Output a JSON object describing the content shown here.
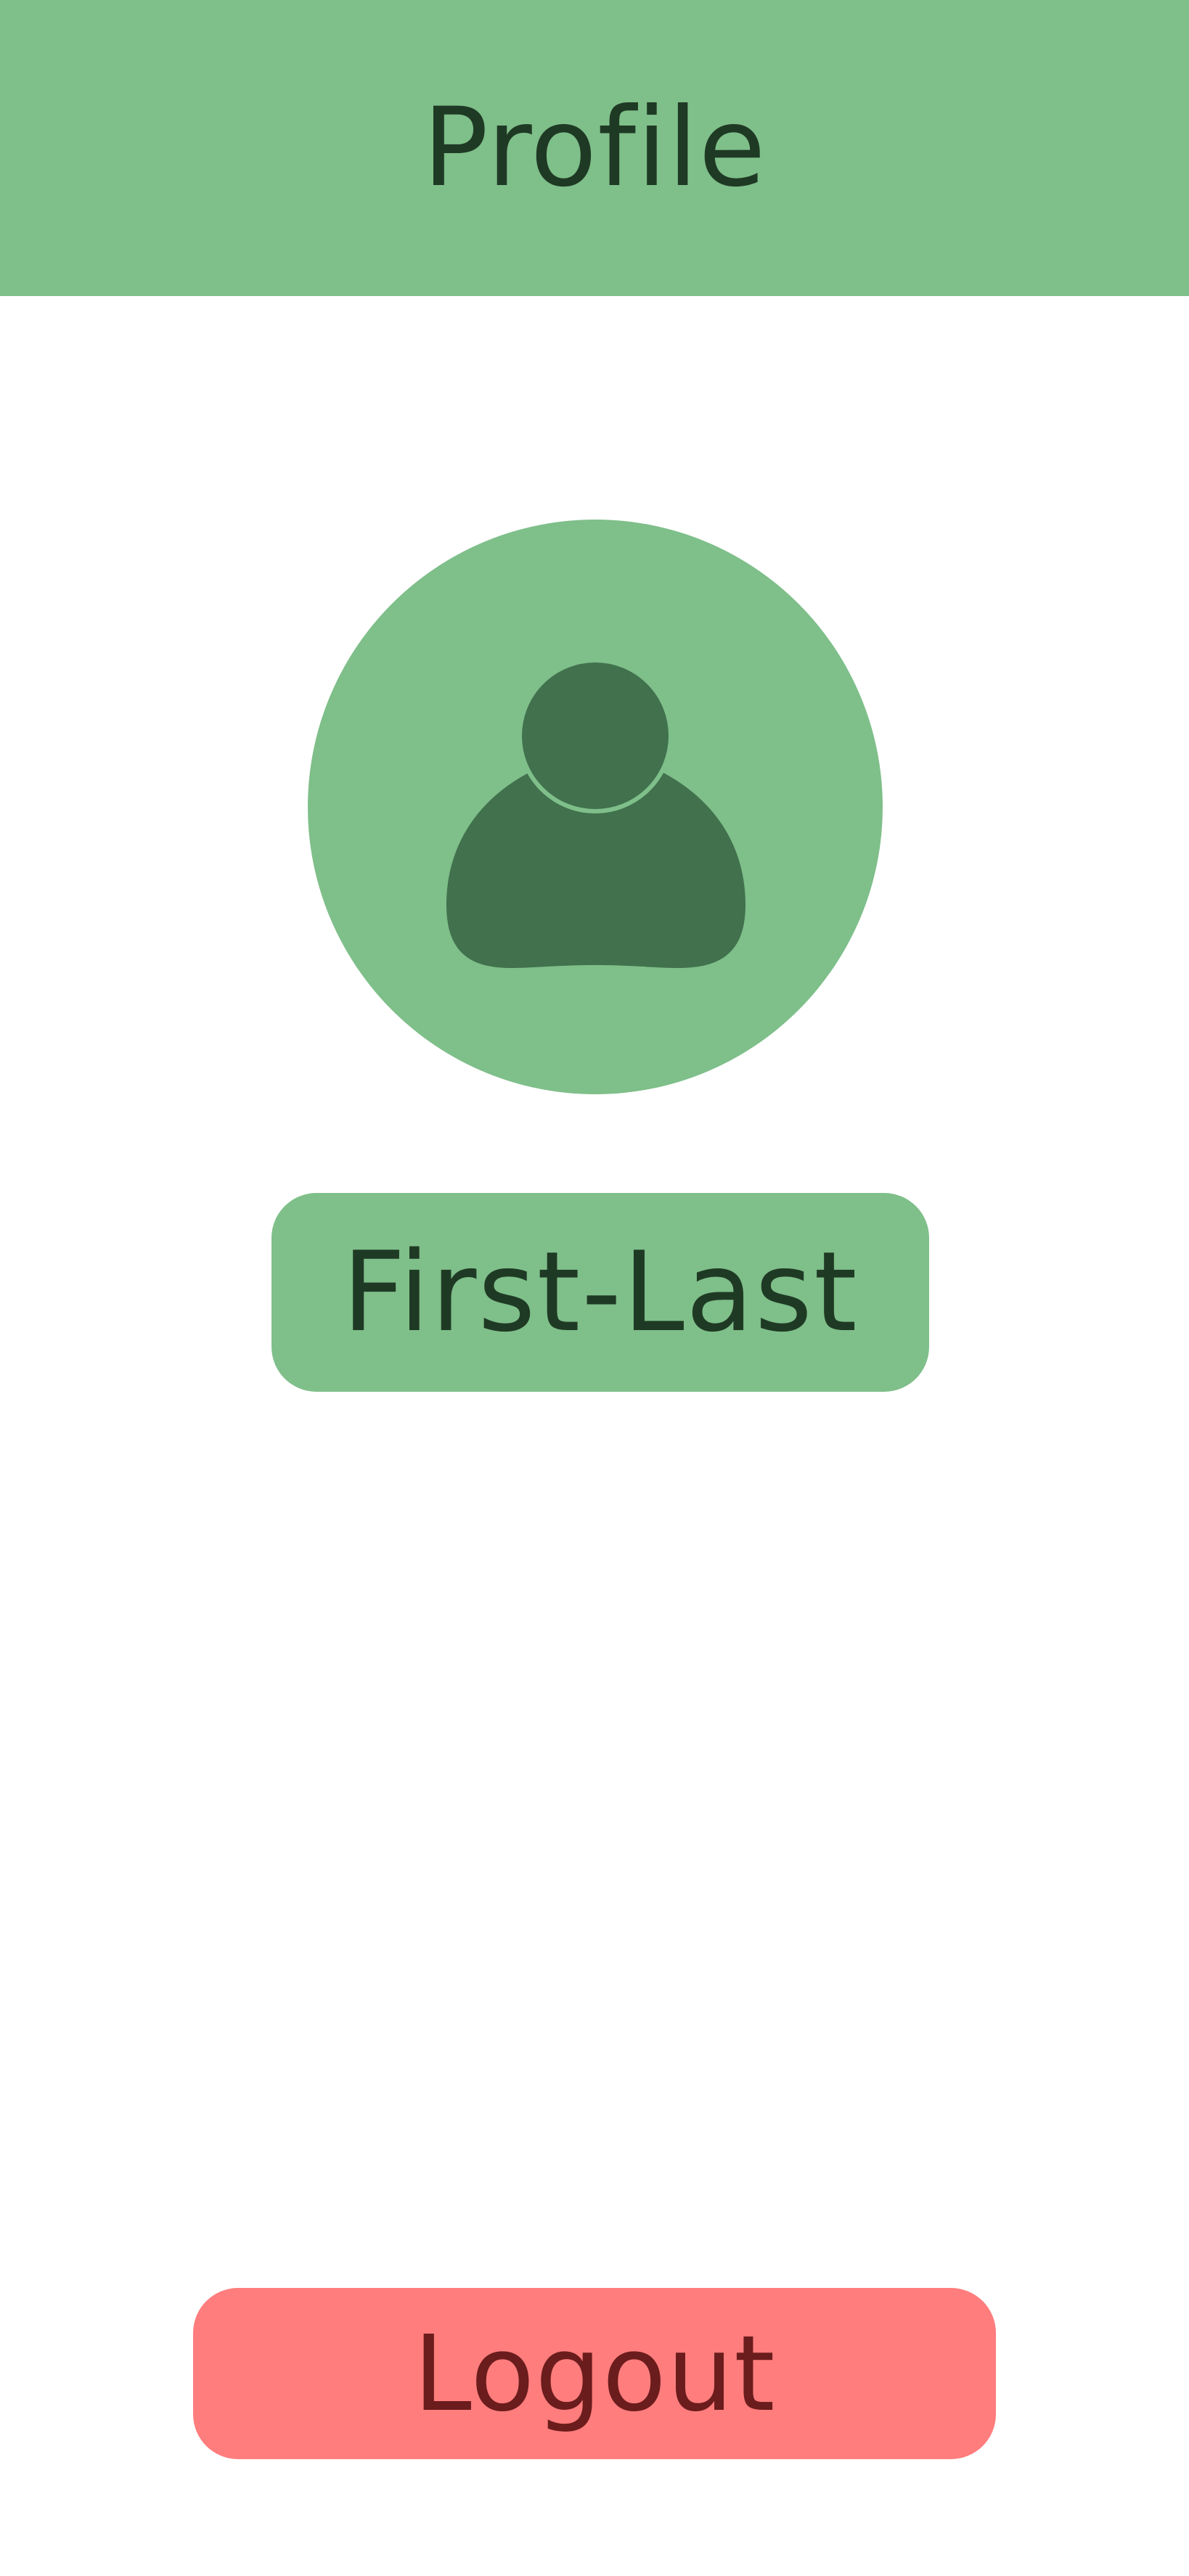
{
  "header": {
    "title": "Profile"
  },
  "profile": {
    "avatar_icon": "person-icon",
    "name": "First-Last"
  },
  "actions": {
    "logout_label": "Logout"
  },
  "colors": {
    "accent_green": "#7fbf8a",
    "dark_green": "#41714d",
    "logout_red": "#ff7d7d"
  }
}
